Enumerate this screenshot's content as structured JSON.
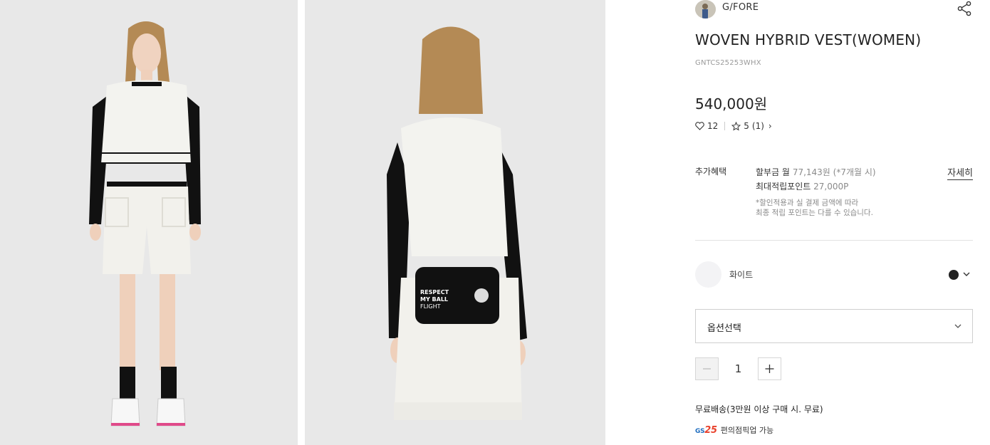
{
  "images": [
    {
      "alt": "front-view-photo"
    },
    {
      "alt": "back-view-photo"
    }
  ],
  "brand": {
    "name": "G/FORE"
  },
  "product": {
    "title": "WOVEN HYBRID VEST(WOMEN)",
    "code": "GNTCS25253WHX",
    "price": "540,000원",
    "likes": "12",
    "rating": "5",
    "review_count": "(1)"
  },
  "benefit": {
    "label": "추가혜택",
    "installment_prefix": "할부금 월",
    "installment_value": "77,143원",
    "installment_note": "(*7개월 시)",
    "points_label": "최대적립포인트",
    "points_value": "27,000P",
    "note_line1": "*할인적용과 실 결제 금액에 따라",
    "note_line2": "최종 적립 포인트는 다를 수 있습니다.",
    "detail_link": "자세히"
  },
  "color": {
    "name": "화이트",
    "swatch_color": "#222222"
  },
  "option": {
    "label": "옵션선택"
  },
  "quantity": {
    "value": "1"
  },
  "shipping": {
    "text": "무료배송(3만원 이상 구매 시. 무료)"
  },
  "pickup": {
    "logo_gs": "GS",
    "logo_25": "25",
    "text": "편의점픽업 가능"
  }
}
